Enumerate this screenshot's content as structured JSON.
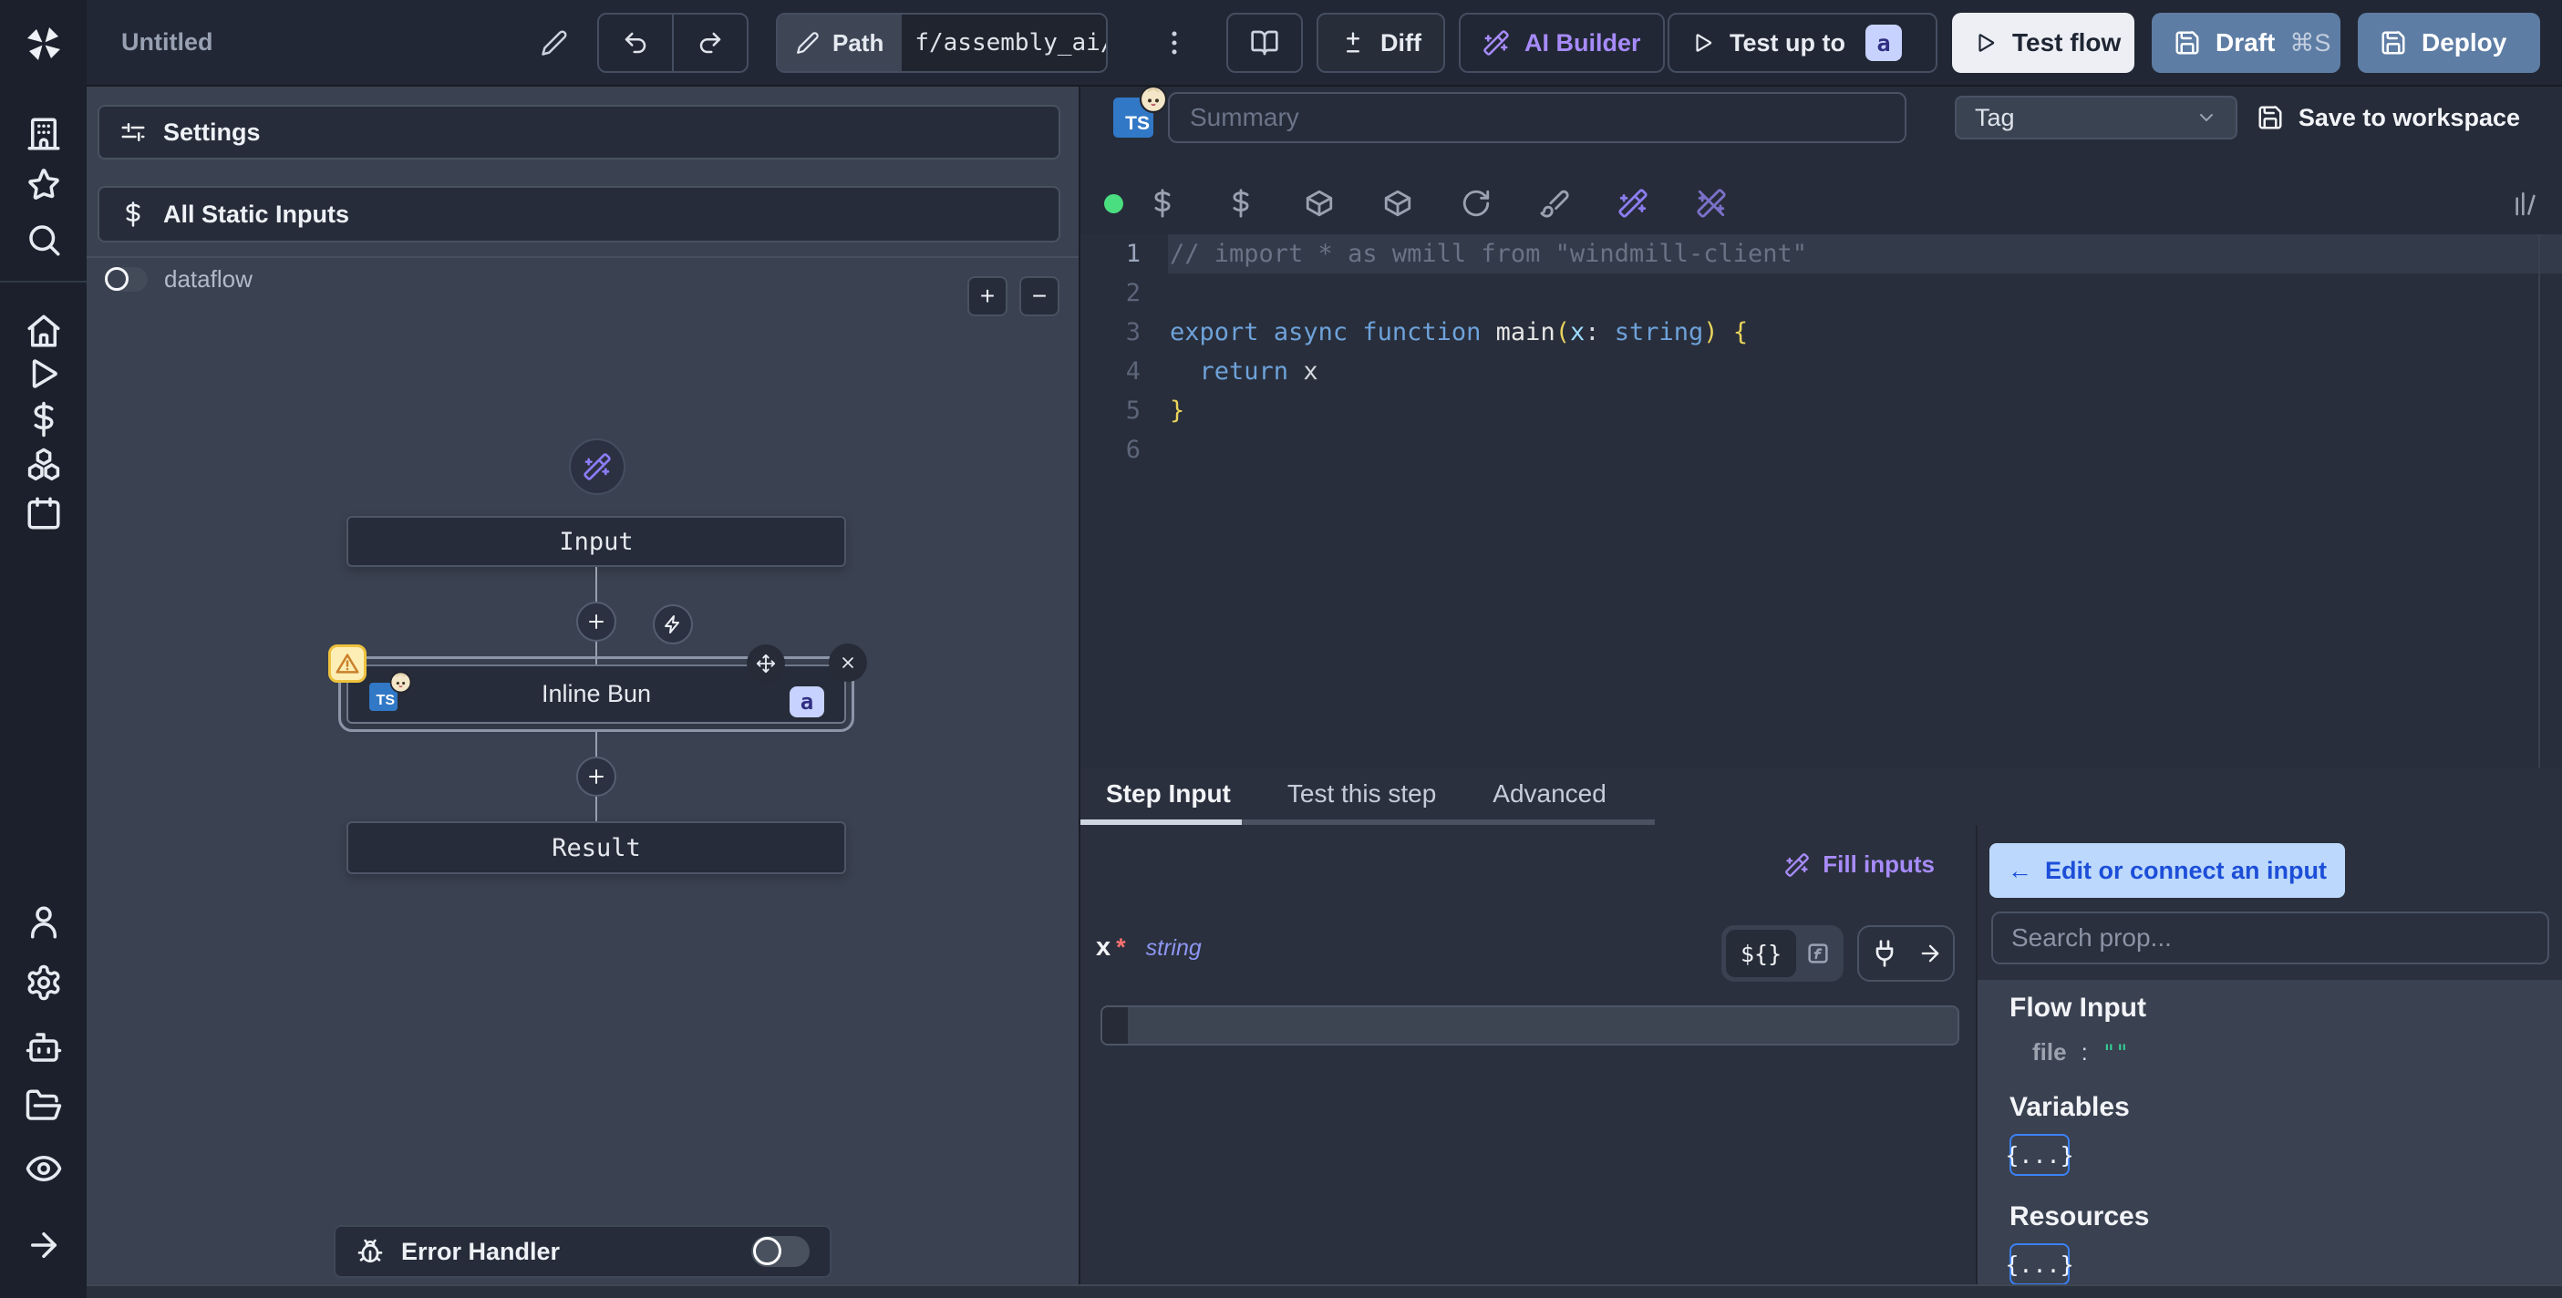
{
  "topbar": {
    "title": "Untitled",
    "path": {
      "label": "Path",
      "value": "f/assembly_ai/"
    },
    "diff_label": "Diff",
    "ai_builder_label": "AI Builder",
    "test_up_to": {
      "label": "Test up to",
      "badge": "a"
    },
    "test_flow_label": "Test flow",
    "draft": {
      "label": "Draft",
      "shortcut": "⌘S"
    },
    "deploy_label": "Deploy"
  },
  "flow_panel": {
    "settings_label": "Settings",
    "all_static_inputs_label": "All Static Inputs",
    "dataflow_label": "dataflow",
    "zoom_in_label": "+",
    "zoom_out_label": "−",
    "graph": {
      "input_label": "Input",
      "step": {
        "label": "Inline Bun",
        "lang_badge": "TS",
        "assignment_badge": "a"
      },
      "result_label": "Result"
    },
    "error_handler_label": "Error Handler"
  },
  "editor": {
    "lang_badge": "TS",
    "summary_placeholder": "Summary",
    "tag_label": "Tag",
    "save_label": "Save to workspace",
    "code_lines": [
      {
        "n": "1",
        "hl": true,
        "tokens": [
          {
            "c": "cm",
            "t": "// import * as wmill from \"windmill-client\""
          }
        ]
      },
      {
        "n": "2",
        "tokens": []
      },
      {
        "n": "3",
        "tokens": [
          {
            "c": "kw",
            "t": "export"
          },
          {
            "c": "pl",
            "t": " "
          },
          {
            "c": "kw",
            "t": "async"
          },
          {
            "c": "pl",
            "t": " "
          },
          {
            "c": "kw",
            "t": "function"
          },
          {
            "c": "pl",
            "t": " "
          },
          {
            "c": "fn",
            "t": "main"
          },
          {
            "c": "br",
            "t": "("
          },
          {
            "c": "vr",
            "t": "x"
          },
          {
            "c": "pl",
            "t": ": "
          },
          {
            "c": "kw",
            "t": "string"
          },
          {
            "c": "br",
            "t": ")"
          },
          {
            "c": "pl",
            "t": " "
          },
          {
            "c": "br",
            "t": "{"
          }
        ]
      },
      {
        "n": "4",
        "tokens": [
          {
            "c": "pl",
            "t": "  "
          },
          {
            "c": "kw",
            "t": "return"
          },
          {
            "c": "pl",
            "t": " x"
          }
        ]
      },
      {
        "n": "5",
        "tokens": [
          {
            "c": "br",
            "t": "}"
          }
        ]
      },
      {
        "n": "6",
        "tokens": []
      }
    ]
  },
  "step_panel": {
    "tabs": [
      {
        "label": "Step Input",
        "active": true
      },
      {
        "label": "Test this step",
        "active": false
      },
      {
        "label": "Advanced",
        "active": false
      }
    ],
    "fill_inputs_label": "Fill inputs",
    "field": {
      "name": "x",
      "required_marker": "*",
      "type": "string",
      "value": ""
    },
    "expr_toggle_label": "${}",
    "fn_toggle_label": "f"
  },
  "prop_panel": {
    "back_arrow": "←",
    "edit_connect_label": "Edit or connect an input",
    "search_placeholder": "Search prop...",
    "flow_input": {
      "title": "Flow Input",
      "key": "file",
      "separator": ":",
      "value": "\"\""
    },
    "variables": {
      "title": "Variables",
      "chip": "{...}"
    },
    "resources": {
      "title": "Resources",
      "chip": "{...}"
    }
  },
  "colors": {
    "accent_purple": "#a78bfa",
    "status_green": "#4ade80",
    "badge_lavender": "#c7d2fe",
    "deploy_blue": "#5e7da4",
    "warning_yellow": "#eec23e",
    "link_blue": "#1d4ed8",
    "chip_border_blue": "#3b82f6",
    "string_green": "#34d399",
    "required_red": "#f87171"
  }
}
